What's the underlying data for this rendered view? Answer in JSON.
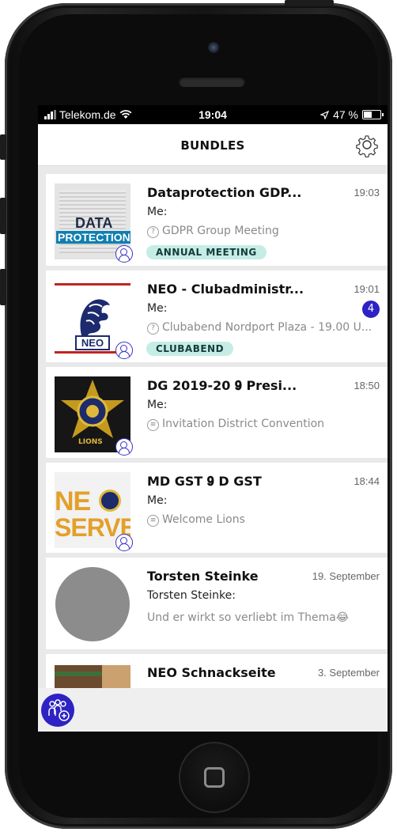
{
  "status_bar": {
    "carrier": "Telekom.de",
    "time": "19:04",
    "battery": "47 %",
    "battery_level": 0.47
  },
  "header": {
    "title": "BUNDLES",
    "settings_icon": "gear-icon"
  },
  "bundles": [
    {
      "title": "Dataprotection GDP...",
      "time": "19:03",
      "sender": "Me:",
      "preview": "GDPR Group Meeting",
      "preview_icon": "?",
      "tag": "ANNUAL MEETING",
      "unread": "",
      "thumb_text_1": "DATA",
      "thumb_text_2": "PROTECTION"
    },
    {
      "title": "NEO - Clubadministr...",
      "time": "19:01",
      "sender": "Me:",
      "preview": "Clubabend Nordport Plaza - 19.00 U...",
      "preview_icon": "?",
      "tag": "CLUBABEND",
      "unread": "4",
      "thumb_text_1": "NEO"
    },
    {
      "title": "DG 2019-20 𝟗 Presi...",
      "time": "18:50",
      "sender": "Me:",
      "preview": "Invitation District Convention",
      "preview_icon": "≡",
      "thumb_text_1": "LIONS"
    },
    {
      "title": "MD GST 𝟗 D GST",
      "time": "18:44",
      "sender": "Me:",
      "preview": "Welcome Lions",
      "preview_icon": "≡",
      "thumb_text_1": "NE",
      "thumb_text_2": "SERVE"
    },
    {
      "title": "Torsten Steinke",
      "time": "19. September",
      "sender": "Torsten Steinke:",
      "preview": "Und er wirkt so verliebt im Thema😂"
    },
    {
      "title": "NEO Schnackseite",
      "time": "3. September"
    }
  ],
  "bottom_bar": {
    "add_group_icon": "add-group-icon"
  },
  "colors": {
    "accent": "#2d22c4",
    "tag_bg": "#c6ece6"
  }
}
